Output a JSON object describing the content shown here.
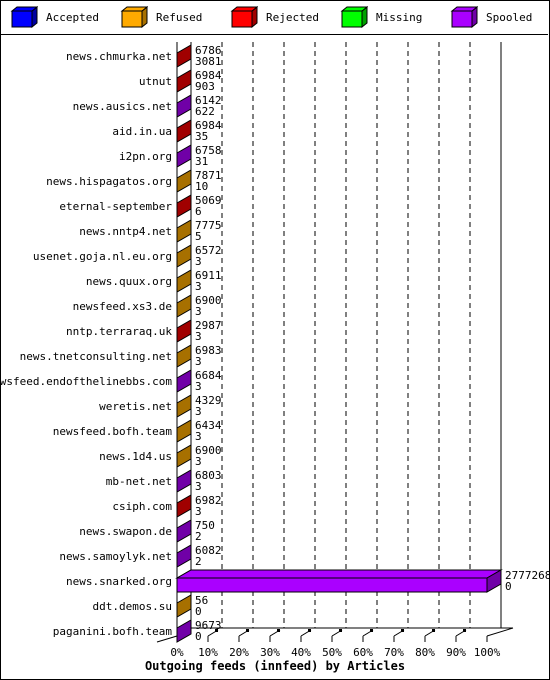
{
  "legend": [
    {
      "label": "Accepted",
      "color": "#0000ff",
      "side": "#0000a0"
    },
    {
      "label": "Refused",
      "color": "#ffaa00",
      "side": "#a77000"
    },
    {
      "label": "Rejected",
      "color": "#ff0000",
      "side": "#a00000"
    },
    {
      "label": "Missing",
      "color": "#00ff00",
      "side": "#00a000"
    },
    {
      "label": "Spooled",
      "color": "#aa00ff",
      "side": "#7000a7"
    }
  ],
  "chart_data": {
    "type": "bar",
    "orientation": "horizontal",
    "stacked": true,
    "title": "Outgoing feeds (innfeed) by Articles",
    "xlabel": "Outgoing feeds (innfeed) by Articles",
    "ylabel": "",
    "xlim": [
      0,
      100
    ],
    "x_unit": "%",
    "x_ticks": [
      "0%",
      "10%",
      "20%",
      "30%",
      "40%",
      "50%",
      "60%",
      "70%",
      "80%",
      "90%",
      "100%"
    ],
    "grid": "vertical dashed",
    "legend_position": "top",
    "series_names": [
      "Accepted",
      "Refused",
      "Rejected",
      "Missing",
      "Spooled"
    ],
    "categories": [
      "news.chmurka.net",
      "utnut",
      "news.ausics.net",
      "aid.in.ua",
      "i2pn.org",
      "news.hispagatos.org",
      "eternal-september",
      "news.nntp4.net",
      "usenet.goja.nl.eu.org",
      "news.quux.org",
      "newsfeed.xs3.de",
      "nntp.terraraq.uk",
      "news.tnetconsulting.net",
      "newsfeed.endofthelinebbs.com",
      "weretis.net",
      "newsfeed.bofh.team",
      "news.1d4.us",
      "mb-net.net",
      "csiph.com",
      "news.swapon.de",
      "news.samoylyk.net",
      "news.snarked.org",
      "ddt.demos.su",
      "paganini.bofh.team"
    ],
    "rows": [
      {
        "host": "news.chmurka.net",
        "top_value": "6786",
        "bottom_value": "3081",
        "dominant": "Rejected",
        "percent": 0.3
      },
      {
        "host": "utnut",
        "top_value": "6984",
        "bottom_value": "903",
        "dominant": "Rejected",
        "percent": 0.3
      },
      {
        "host": "news.ausics.net",
        "top_value": "6142",
        "bottom_value": "622",
        "dominant": "Spooled",
        "percent": 0.2
      },
      {
        "host": "aid.in.ua",
        "top_value": "6984",
        "bottom_value": "35",
        "dominant": "Rejected",
        "percent": 0.3
      },
      {
        "host": "i2pn.org",
        "top_value": "6758",
        "bottom_value": "31",
        "dominant": "Spooled",
        "percent": 0.2
      },
      {
        "host": "news.hispagatos.org",
        "top_value": "7871",
        "bottom_value": "10",
        "dominant": "Refused",
        "percent": 0.3
      },
      {
        "host": "eternal-september",
        "top_value": "5069",
        "bottom_value": "6",
        "dominant": "Rejected",
        "percent": 0.2
      },
      {
        "host": "news.nntp4.net",
        "top_value": "7775",
        "bottom_value": "5",
        "dominant": "Refused",
        "percent": 0.3
      },
      {
        "host": "usenet.goja.nl.eu.org",
        "top_value": "6572",
        "bottom_value": "3",
        "dominant": "Refused",
        "percent": 0.2
      },
      {
        "host": "news.quux.org",
        "top_value": "6911",
        "bottom_value": "3",
        "dominant": "Refused",
        "percent": 0.2
      },
      {
        "host": "newsfeed.xs3.de",
        "top_value": "6900",
        "bottom_value": "3",
        "dominant": "Refused",
        "percent": 0.2
      },
      {
        "host": "nntp.terraraq.uk",
        "top_value": "2987",
        "bottom_value": "3",
        "dominant": "Rejected",
        "percent": 0.1
      },
      {
        "host": "news.tnetconsulting.net",
        "top_value": "6983",
        "bottom_value": "3",
        "dominant": "Refused",
        "percent": 0.2
      },
      {
        "host": "newsfeed.endofthelinebbs.com",
        "top_value": "6684",
        "bottom_value": "3",
        "dominant": "Spooled",
        "percent": 0.2
      },
      {
        "host": "weretis.net",
        "top_value": "4329",
        "bottom_value": "3",
        "dominant": "Refused",
        "percent": 0.2
      },
      {
        "host": "newsfeed.bofh.team",
        "top_value": "6434",
        "bottom_value": "3",
        "dominant": "Refused",
        "percent": 0.2
      },
      {
        "host": "news.1d4.us",
        "top_value": "6900",
        "bottom_value": "3",
        "dominant": "Refused",
        "percent": 0.2
      },
      {
        "host": "mb-net.net",
        "top_value": "6803",
        "bottom_value": "3",
        "dominant": "Spooled",
        "percent": 0.2
      },
      {
        "host": "csiph.com",
        "top_value": "6982",
        "bottom_value": "3",
        "dominant": "Rejected",
        "percent": 0.3
      },
      {
        "host": "news.swapon.de",
        "top_value": "750",
        "bottom_value": "2",
        "dominant": "Spooled",
        "percent": 0.03
      },
      {
        "host": "news.samoylyk.net",
        "top_value": "6082",
        "bottom_value": "2",
        "dominant": "Spooled",
        "percent": 0.2
      },
      {
        "host": "news.snarked.org",
        "top_value": "2777268",
        "bottom_value": "0",
        "dominant": "Spooled",
        "percent": 100
      },
      {
        "host": "ddt.demos.su",
        "top_value": "56",
        "bottom_value": "0",
        "dominant": "Refused",
        "percent": 0.002
      },
      {
        "host": "paganini.bofh.team",
        "top_value": "9673",
        "bottom_value": "0",
        "dominant": "Spooled",
        "percent": 0.3
      }
    ]
  }
}
